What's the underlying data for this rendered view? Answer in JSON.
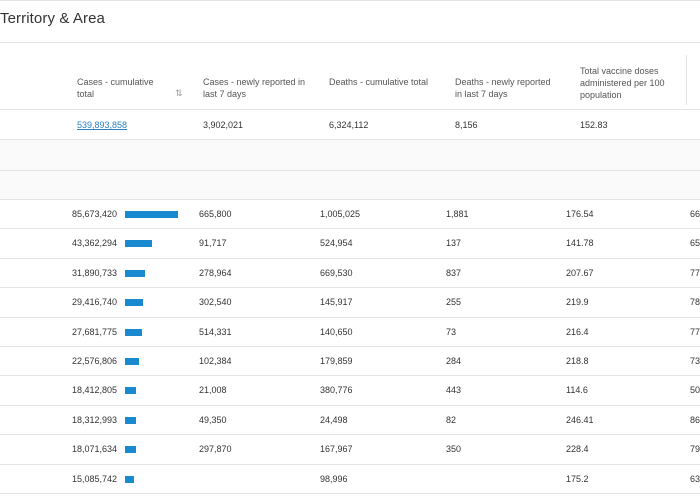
{
  "page": {
    "title": "Territory & Area"
  },
  "headers": [
    "Cases - cumulative total",
    "Cases - newly reported in last 7 days",
    "Deaths - cumulative total",
    "Deaths - newly reported in last 7 days",
    "Total vaccine doses administered per 100 population"
  ],
  "sort_icon": "sort-icon",
  "global_row": {
    "cases_cumulative": "539,893,858",
    "cases_7d": "3,902,021",
    "deaths_cumulative": "6,324,112",
    "deaths_7d": "8,156",
    "vaccine_per_100": "152.83"
  },
  "rows": [
    {
      "cases_cumulative": "85,673,420",
      "cases_7d": "665,800",
      "deaths_cumulative": "1,005,025",
      "deaths_7d": "1,881",
      "vaccine_per_100": "176.54",
      "next_col": "66"
    },
    {
      "cases_cumulative": "43,362,294",
      "cases_7d": "91,717",
      "deaths_cumulative": "524,954",
      "deaths_7d": "137",
      "vaccine_per_100": "141.78",
      "next_col": "65"
    },
    {
      "cases_cumulative": "31,890,733",
      "cases_7d": "278,964",
      "deaths_cumulative": "669,530",
      "deaths_7d": "837",
      "vaccine_per_100": "207.67",
      "next_col": "77"
    },
    {
      "cases_cumulative": "29,416,740",
      "cases_7d": "302,540",
      "deaths_cumulative": "145,917",
      "deaths_7d": "255",
      "vaccine_per_100": "219.9",
      "next_col": "78"
    },
    {
      "cases_cumulative": "27,681,775",
      "cases_7d": "514,331",
      "deaths_cumulative": "140,650",
      "deaths_7d": "73",
      "vaccine_per_100": "216.4",
      "next_col": "77"
    },
    {
      "cases_cumulative": "22,576,806",
      "cases_7d": "102,384",
      "deaths_cumulative": "179,859",
      "deaths_7d": "284",
      "vaccine_per_100": "218.8",
      "next_col": "73"
    },
    {
      "cases_cumulative": "18,412,805",
      "cases_7d": "21,008",
      "deaths_cumulative": "380,776",
      "deaths_7d": "443",
      "vaccine_per_100": "114.6",
      "next_col": "50"
    },
    {
      "cases_cumulative": "18,312,993",
      "cases_7d": "49,350",
      "deaths_cumulative": "24,498",
      "deaths_7d": "82",
      "vaccine_per_100": "246.41",
      "next_col": "86"
    },
    {
      "cases_cumulative": "18,071,634",
      "cases_7d": "297,870",
      "deaths_cumulative": "167,967",
      "deaths_7d": "350",
      "vaccine_per_100": "228.4",
      "next_col": "79"
    },
    {
      "cases_cumulative": "15,085,742",
      "cases_7d": "",
      "deaths_cumulative": "98,996",
      "deaths_7d": "",
      "vaccine_per_100": "175.2",
      "next_col": "63"
    }
  ],
  "bar_fraction": [
    1.0,
    0.506,
    0.372,
    0.343,
    0.323,
    0.264,
    0.215,
    0.214,
    0.211,
    0.176
  ],
  "colors": {
    "bar": "#1a8ad0",
    "link": "#2a7fc0"
  }
}
